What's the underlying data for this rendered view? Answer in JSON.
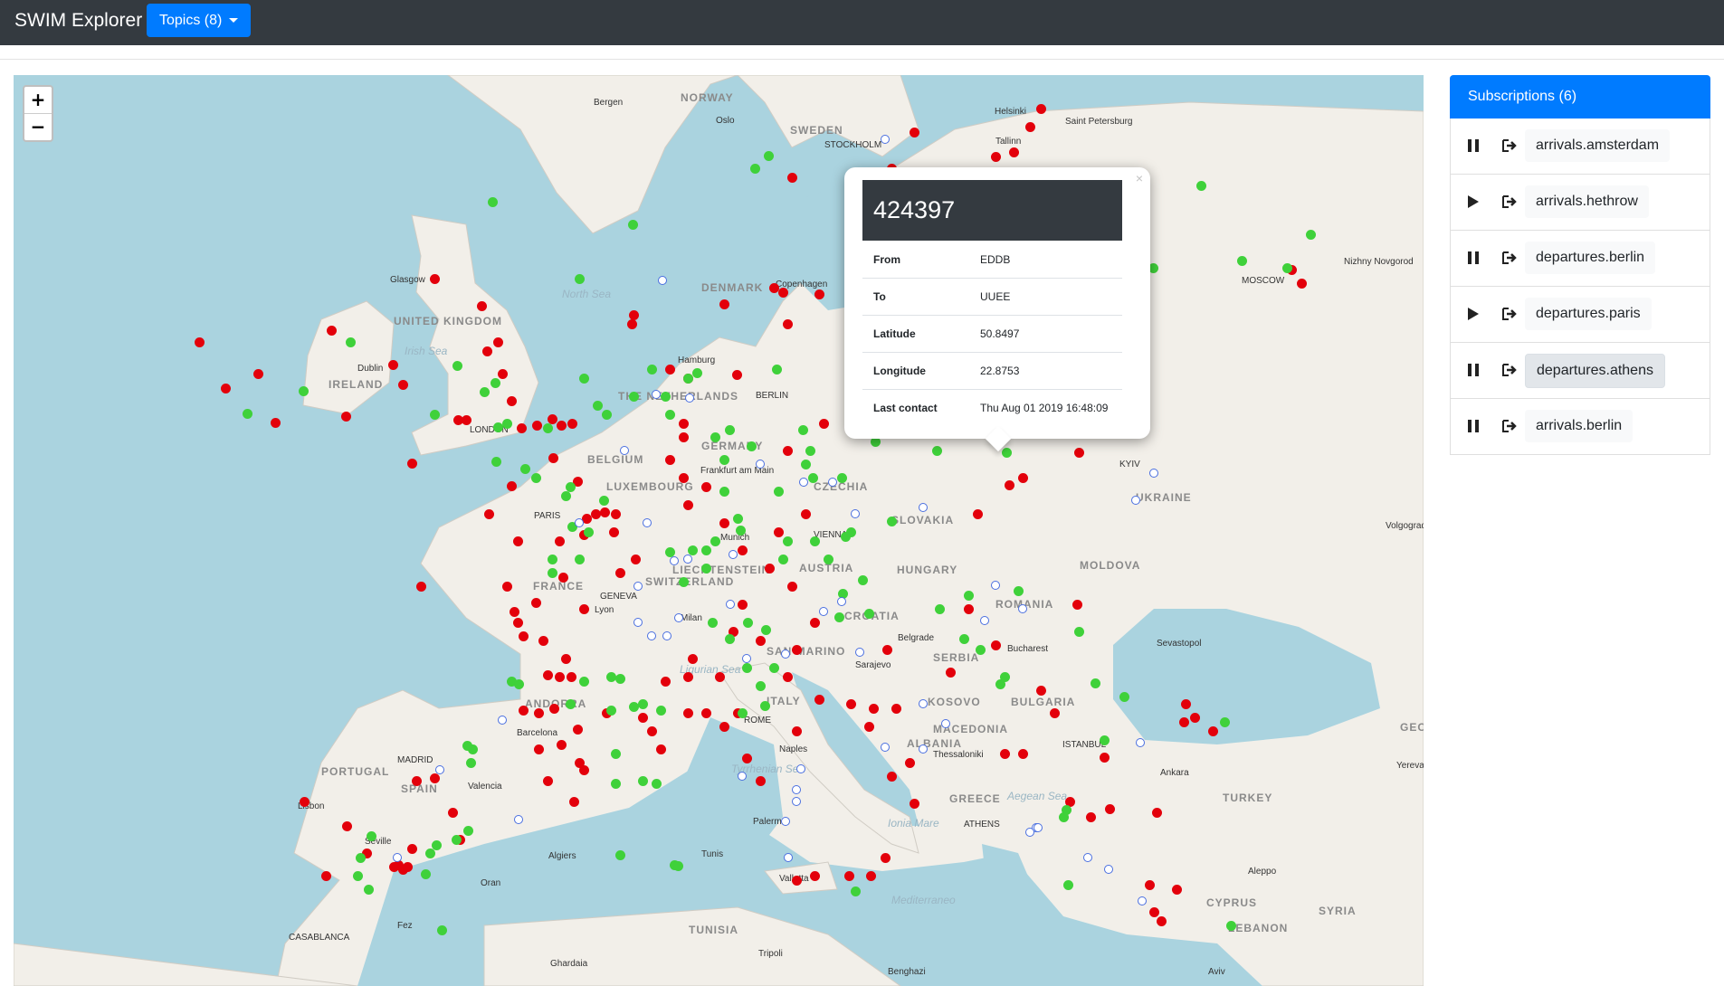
{
  "navbar": {
    "brand": "SWIM Explorer",
    "topics_label": "Topics (8)"
  },
  "map": {
    "zoom_in": "+",
    "zoom_out": "−",
    "city_labels": [
      "Bergen",
      "Oslo",
      "STOCKHOLM",
      "Helsinki",
      "Tallinn",
      "Saint Petersburg",
      "Glasgow",
      "Dublin",
      "Copenhagen",
      "Hamburg",
      "BERLIN",
      "MOSCOW",
      "Nizhny Novgorod",
      "LONDON",
      "Frankfurt am Main",
      "PARIS",
      "Munich",
      "VIENNA",
      "GENEVA",
      "Lyon",
      "Milan",
      "Belgrade",
      "Bucharest",
      "Sarajevo",
      "KYIV",
      "Sevastopol",
      "Volgograd",
      "ROME",
      "Naples",
      "Barcelona",
      "MADRID",
      "Valencia",
      "Lisbon",
      "Seville",
      "Algiers",
      "Tunis",
      "Palermo",
      "Valletta",
      "ISTANBUL",
      "Ankara",
      "Thessaloniki",
      "ATHENS",
      "Tripoli",
      "Benghazi",
      "Ghardaia",
      "Fez",
      "CASABLANCA",
      "Oran",
      "Aleppo",
      "Yerevan",
      "Aviv"
    ],
    "country_labels": [
      "NORWAY",
      "SWEDEN",
      "DENMARK",
      "UNITED KINGDOM",
      "IRELAND",
      "THE NETHERLANDS",
      "BELGIUM",
      "LUXEMBOURG",
      "GERMANY",
      "CZECHIA",
      "SLOVAKIA",
      "AUSTRIA",
      "LIECHTENSTEIN",
      "SWITZERLAND",
      "FRANCE",
      "HUNGARY",
      "CROATIA",
      "SAN MARINO",
      "ROMANIA",
      "MOLDOVA",
      "UKRAINE",
      "SERBIA",
      "KOSOVO",
      "BULGARIA",
      "MACEDONIA",
      "ALBANIA",
      "ITALY",
      "ANDORRA",
      "PORTUGAL",
      "SPAIN",
      "GREECE",
      "TURKEY",
      "CYPRUS",
      "SYRIA",
      "LEBANON",
      "TUNISIA",
      "GEO"
    ],
    "sea_labels": [
      "North Sea",
      "Irish Sea",
      "Ligurian Sea",
      "Tyrrhenian Sea",
      "Ionia Mare",
      "Aegean Sea",
      "Mediterraneo"
    ]
  },
  "popup": {
    "title": "424397",
    "close": "×",
    "rows": [
      {
        "label": "From",
        "value": "EDDB"
      },
      {
        "label": "To",
        "value": "UUEE"
      },
      {
        "label": "Latitude",
        "value": "50.8497"
      },
      {
        "label": "Longitude",
        "value": "22.8753"
      },
      {
        "label": "Last contact",
        "value": "Thu Aug 01 2019 16:48:09"
      }
    ]
  },
  "subscriptions": {
    "title": "Subscriptions (6)",
    "items": [
      {
        "name": "arrivals.amsterdam",
        "state": "paused-icon"
      },
      {
        "name": "arrivals.hethrow",
        "state": "play-icon"
      },
      {
        "name": "departures.berlin",
        "state": "paused-icon"
      },
      {
        "name": "departures.paris",
        "state": "play-icon"
      },
      {
        "name": "departures.athens",
        "state": "paused-icon"
      },
      {
        "name": "arrivals.berlin",
        "state": "paused-icon"
      }
    ]
  },
  "colors": {
    "navbar": "#343a40",
    "primary": "#007bff",
    "marker_red": "#e3000b",
    "marker_green": "#3fd13a",
    "marker_blue": "#4a6fe0",
    "sea": "#aad3df",
    "land": "#f2efe9"
  }
}
